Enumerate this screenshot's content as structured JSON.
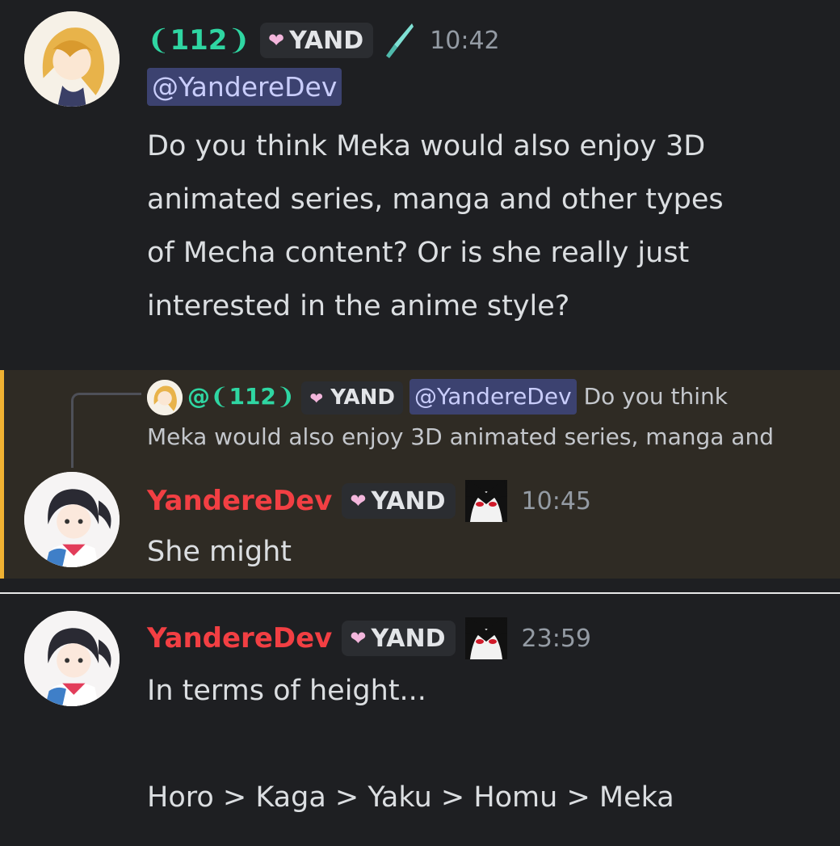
{
  "message1": {
    "username": "❨112❩",
    "role_tag": "YAND",
    "time": "10:42",
    "mention": "@YandereDev",
    "lines": [
      "Do you think Meka would also enjoy 3D",
      "animated series, manga and other types",
      "of Mecha content? Or is she really just",
      "interested in the anime style?"
    ]
  },
  "reply": {
    "name": "@❨112❩",
    "role_tag": "YAND",
    "mention": "@YandereDev",
    "text_start": "Do you think",
    "text_rest": "Meka would also enjoy 3D animated series, manga and"
  },
  "message2": {
    "username": "YandereDev",
    "role_tag": "YAND",
    "time": "10:45",
    "text": "She might"
  },
  "message3": {
    "username": "YandereDev",
    "role_tag": "YAND",
    "time": "23:59",
    "line1": "In terms of height...",
    "line2": "Horo > Kaga > Yaku > Homu > Meka"
  },
  "colors": {
    "background": "#1e1f22",
    "highlight": "#2f2b24",
    "highlight_bar": "#f0b232",
    "name_green": "#2fd6a2",
    "name_red": "#f23f43",
    "mention_bg": "#3c4270"
  }
}
